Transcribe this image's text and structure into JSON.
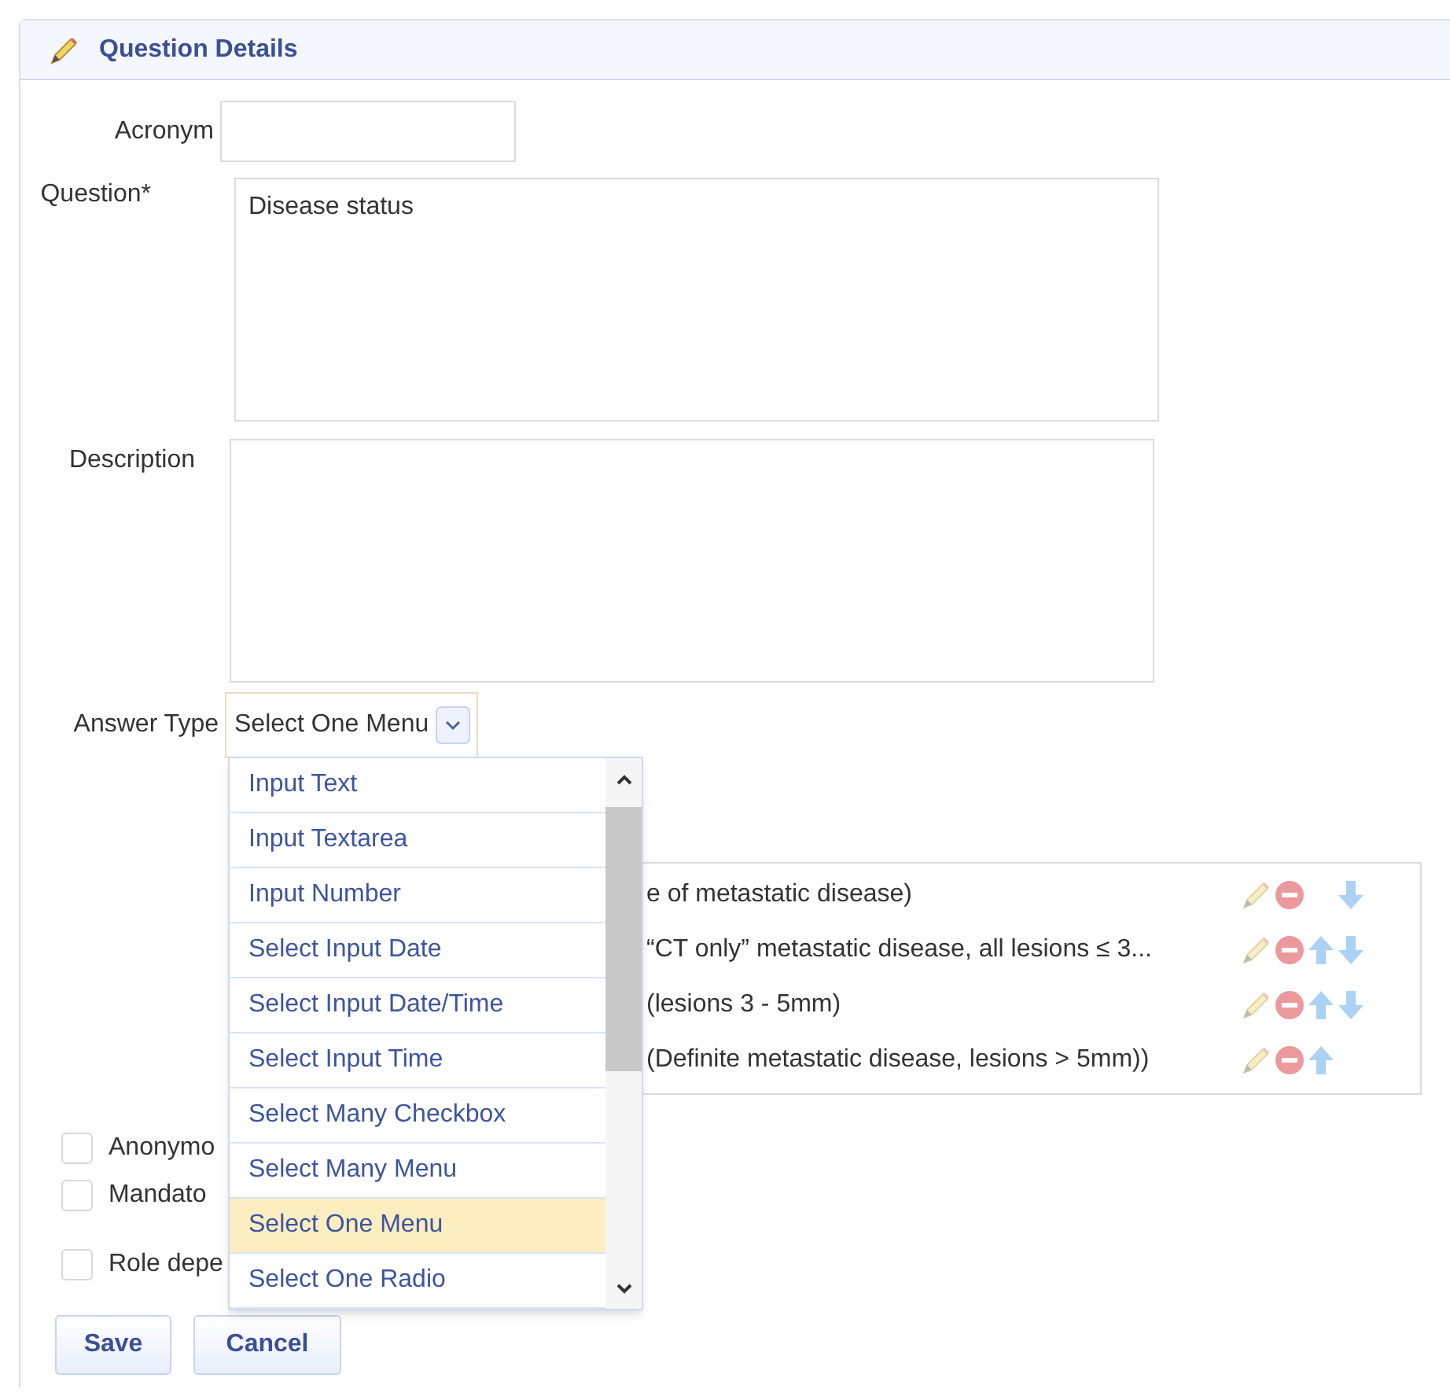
{
  "panel": {
    "title": "Question Details"
  },
  "fields": {
    "acronym": {
      "label": "Acronym"
    },
    "question": {
      "label": "Question*",
      "value": "Disease status"
    },
    "description": {
      "label": "Description"
    },
    "answer_type": {
      "label": "Answer Type",
      "value": "Select One Menu"
    }
  },
  "answers": [
    {
      "text": "e of metastatic disease)",
      "can_move_up": false,
      "can_move_down": true
    },
    {
      "text": "“CT only” metastatic disease, all lesions ≤ 3...",
      "can_move_up": true,
      "can_move_down": true
    },
    {
      "text": "(lesions 3 - 5mm)",
      "can_move_up": true,
      "can_move_down": true
    },
    {
      "text": "(Definite metastatic disease, lesions > 5mm))",
      "can_move_up": true,
      "can_move_down": false
    }
  ],
  "checkboxes": [
    {
      "label": "Anonymo",
      "checked": false
    },
    {
      "label": "Mandato",
      "checked": false
    },
    {
      "label": "Role depe",
      "checked": false
    }
  ],
  "buttons": [
    "Save",
    "Cancel"
  ],
  "dropdown_options": [
    {
      "label": "Input Text",
      "selected": false
    },
    {
      "label": "Input Textarea",
      "selected": false
    },
    {
      "label": "Input Number",
      "selected": false
    },
    {
      "label": "Select Input Date",
      "selected": false
    },
    {
      "label": "Select Input Date/Time",
      "selected": false
    },
    {
      "label": "Select Input Time",
      "selected": false
    },
    {
      "label": "Select Many Checkbox",
      "selected": false
    },
    {
      "label": "Select Many Menu",
      "selected": false
    },
    {
      "label": "Select One Menu",
      "selected": true
    },
    {
      "label": "Select One Radio",
      "selected": false
    }
  ]
}
